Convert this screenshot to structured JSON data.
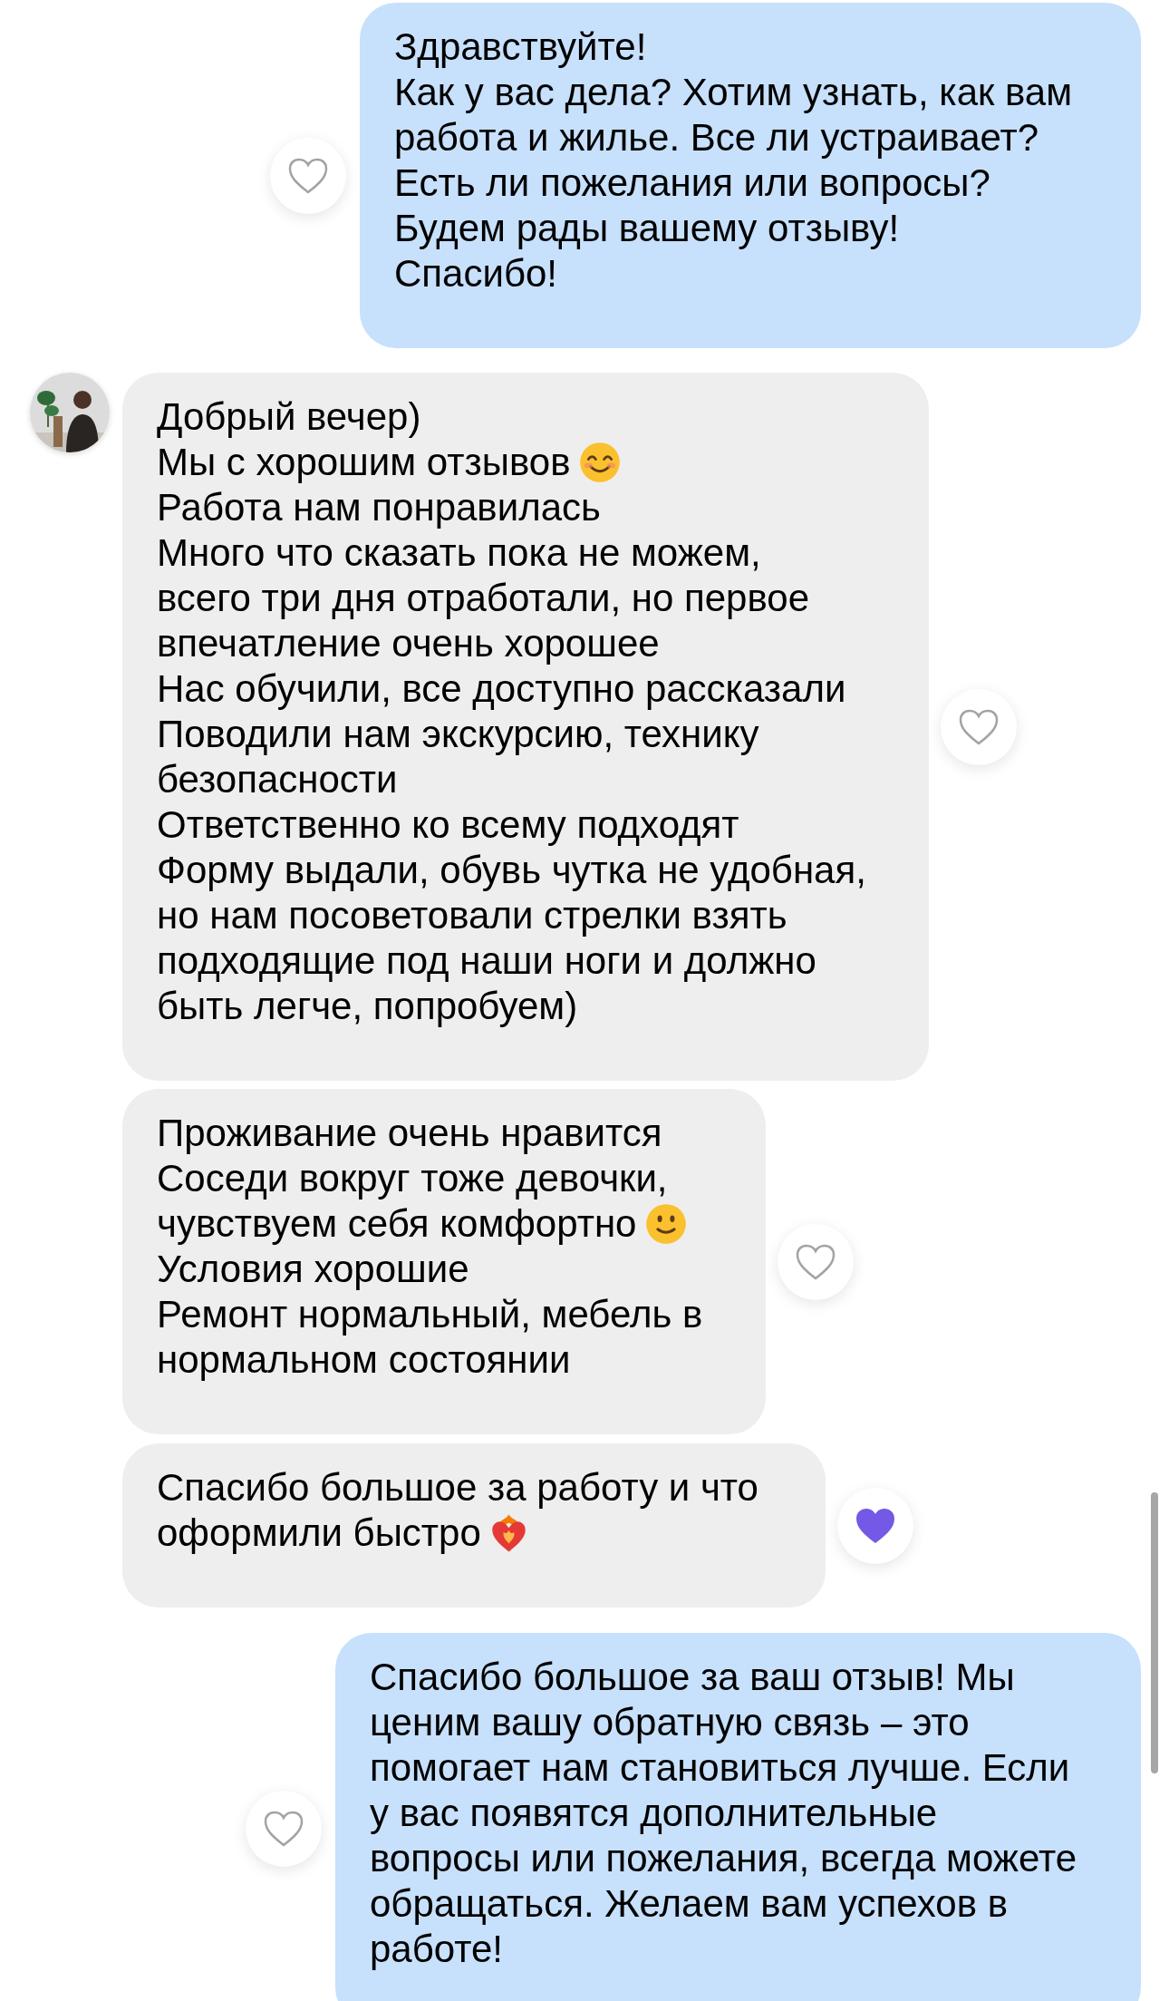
{
  "messages": [
    {
      "kind": "outgoing",
      "reaction": {
        "liked": false
      },
      "lines": [
        {
          "kind": "plain",
          "text": "Здравствуйте!"
        },
        {
          "kind": "plain",
          "text": "Как у вас дела? Хотим узнать, как вам"
        },
        {
          "kind": "plain",
          "text": "работа и жилье. Все ли устраивает?"
        },
        {
          "kind": "plain",
          "text": "Есть ли пожелания или вопросы?"
        },
        {
          "kind": "plain",
          "text": "Будем рады вашему отзыву!"
        },
        {
          "kind": "plain",
          "text": "Спасибо!"
        }
      ]
    },
    {
      "kind": "incoming",
      "reaction": {
        "liked": false
      },
      "lines": [
        {
          "kind": "plain",
          "text": "Добрый вечер)"
        },
        {
          "kind": "smile",
          "text": "Мы с хорошим отзывов"
        },
        {
          "kind": "plain",
          "text": "Работа нам понравилась"
        },
        {
          "kind": "plain",
          "text": "Много что сказать пока не можем,"
        },
        {
          "kind": "plain",
          "text": "всего три дня отработали, но первое"
        },
        {
          "kind": "plain",
          "text": "впечатление очень хорошее"
        },
        {
          "kind": "plain",
          "text": "Нас обучили, все доступно рассказали"
        },
        {
          "kind": "plain",
          "text": "Поводили нам экскурсию, технику"
        },
        {
          "kind": "plain",
          "text": "безопасности"
        },
        {
          "kind": "plain",
          "text": "Ответственно ко всему подходят"
        },
        {
          "kind": "plain",
          "text": "Форму выдали, обувь чутка не удобная,"
        },
        {
          "kind": "plain",
          "text": "но нам посоветовали стрелки взять"
        },
        {
          "kind": "plain",
          "text": "подходящие под наши ноги и должно"
        },
        {
          "kind": "plain",
          "text": "быть легче, попробуем)"
        }
      ]
    },
    {
      "kind": "incoming",
      "reaction": {
        "liked": false
      },
      "lines": [
        {
          "kind": "plain",
          "text": "Проживание очень нравится"
        },
        {
          "kind": "plain",
          "text": "Соседи вокруг тоже девочки,"
        },
        {
          "kind": "slight_smile",
          "text": "чувствуем себя комфортно"
        },
        {
          "kind": "plain",
          "text": "Условия хорошие"
        },
        {
          "kind": "plain",
          "text": "Ремонт нормальный, мебель в"
        },
        {
          "kind": "plain",
          "text": "нормальном состоянии"
        }
      ]
    },
    {
      "kind": "incoming",
      "reaction": {
        "liked": true
      },
      "lines": [
        {
          "kind": "plain",
          "text": "Спасибо большое за работу и что"
        },
        {
          "kind": "heart_fire",
          "text": "оформили быстро"
        }
      ]
    },
    {
      "kind": "outgoing",
      "reaction": {
        "liked": false
      },
      "lines": [
        {
          "kind": "plain",
          "text": "Спасибо большое за ваш отзыв! Мы"
        },
        {
          "kind": "plain",
          "text": "ценим вашу обратную связь – это"
        },
        {
          "kind": "plain",
          "text": "помогает нам становиться лучше. Если"
        },
        {
          "kind": "plain",
          "text": "у вас появятся дополнительные"
        },
        {
          "kind": "plain",
          "text": "вопросы или пожелания, всегда можете"
        },
        {
          "kind": "plain",
          "text": "обращаться. Желаем вам успехов в"
        },
        {
          "kind": "plain",
          "text": "работе!"
        }
      ]
    }
  ]
}
